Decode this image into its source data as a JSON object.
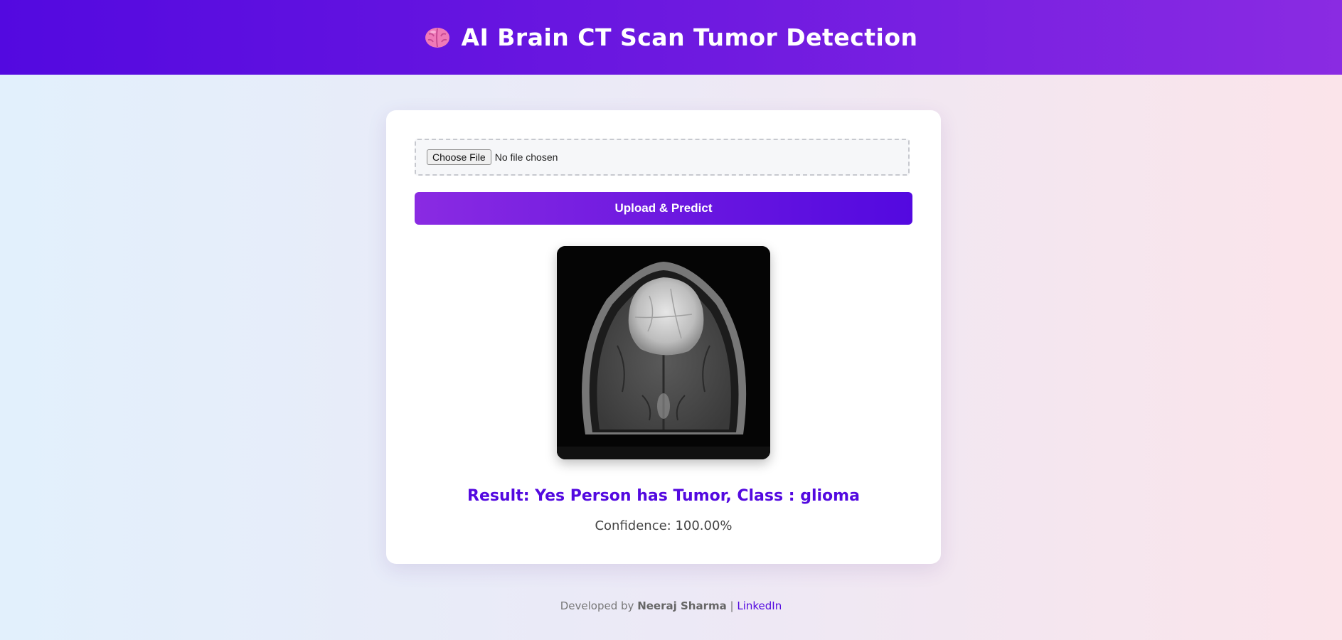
{
  "header": {
    "icon": "brain-icon",
    "title": "AI Brain CT Scan Tumor Detection"
  },
  "upload": {
    "choose_label": "Choose File",
    "file_status": "No file chosen",
    "predict_label": "Upload & Predict"
  },
  "preview": {
    "image": "brain-scan-image"
  },
  "result": {
    "text": "Result: Yes Person has Tumor, Class : glioma",
    "confidence": "Confidence: 100.00%"
  },
  "footer": {
    "prefix": "Developed by",
    "author": "Neeraj Sharma",
    "separator": "|",
    "link": "LinkedIn"
  },
  "colors": {
    "accent": "#5309e0",
    "accent_light": "#8a2be2"
  }
}
